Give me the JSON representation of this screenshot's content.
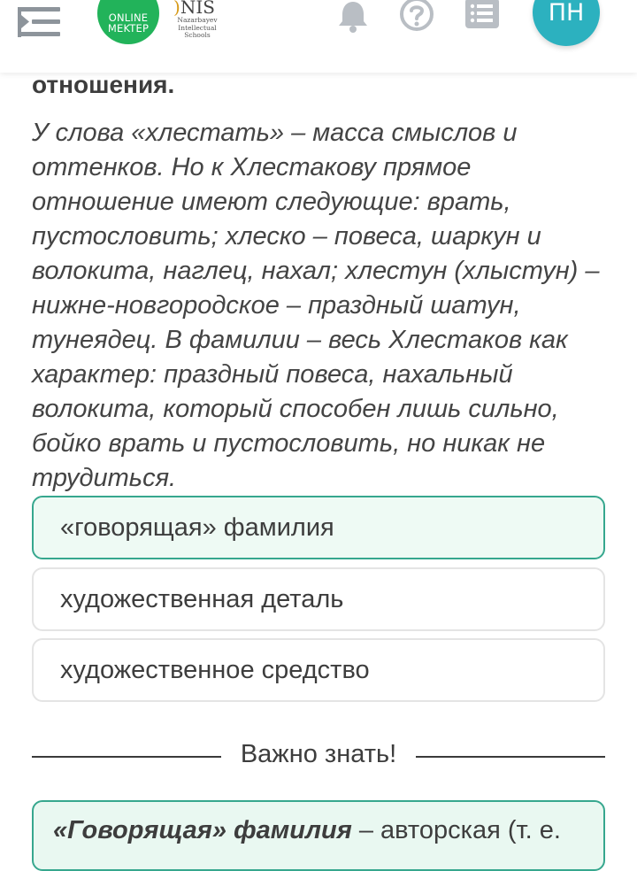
{
  "header": {
    "menu_icon": "menu-icon",
    "logo_online_mektep": {
      "line1": "ONLINE",
      "line2": "MEKTEP"
    },
    "logo_nis": {
      "mark": "NIS",
      "line1": "Nazarbayev",
      "line2": "Intellectual",
      "line3": "Schools"
    },
    "bell_icon": "bell-icon",
    "help_icon": "help-icon",
    "list_icon": "list-icon",
    "avatar_initials": "ПН"
  },
  "content": {
    "heading": "отношения.",
    "paragraph": "У слова «хлестать» – масса смыслов и оттенков. Но к Хлестакову прямое отношение имеют следующие: врать, пустословить; хлеско – повеса, шаркун и волокита, наглец, нахал; хлестун (хлыстун) – нижне-новгородское – праздный шатун, тунеядец. В фамилии – весь Хлестаков как характер: праздный повеса, нахальный волокита, который способен лишь сильно, бойко врать и пустословить, но никак не трудиться.",
    "options": [
      {
        "label": "«говорящая» фамилия",
        "selected": true
      },
      {
        "label": "художественная деталь",
        "selected": false
      },
      {
        "label": "художественное средство",
        "selected": false
      }
    ],
    "divider_label": "Важно знать!",
    "info": {
      "term": "«Говорящая» фамилия",
      "rest": " – авторская (т. е."
    }
  },
  "colors": {
    "accent_green": "#36a78e",
    "selected_bg": "#eefaf4",
    "logo_green": "#22b35a",
    "avatar_teal": "#2cb1bf",
    "icon_grey": "#b9bec4"
  }
}
